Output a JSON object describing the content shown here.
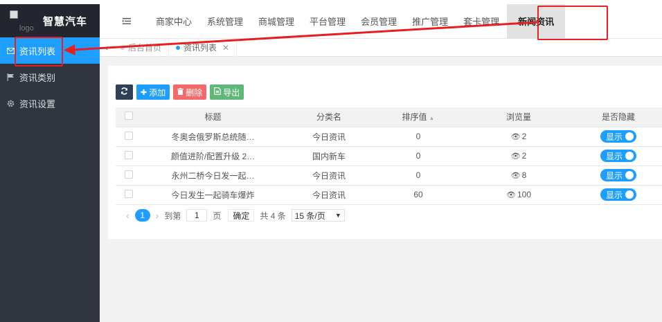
{
  "sidebar": {
    "logo_alt": "logo",
    "title": "智慧汽车",
    "items": [
      {
        "label": "资讯列表",
        "icon": "envelope-icon",
        "active": true
      },
      {
        "label": "资讯类别",
        "icon": "flag-icon",
        "active": false
      },
      {
        "label": "资讯设置",
        "icon": "gear-icon",
        "active": false
      }
    ]
  },
  "topnav": {
    "items": [
      "商家中心",
      "系统管理",
      "商城管理",
      "平台管理",
      "会员管理",
      "推广管理",
      "套卡管理",
      "新闻资讯"
    ],
    "active_index": 7
  },
  "tabs": {
    "items": [
      {
        "label": "后台首页",
        "active": false
      },
      {
        "label": "资讯列表",
        "active": true,
        "closable": true
      }
    ]
  },
  "toolbar": {
    "refresh_icon": "refresh-icon",
    "add_label": "添加",
    "delete_label": "删除",
    "export_label": "导出"
  },
  "table": {
    "headers": {
      "title": "标题",
      "category": "分类名",
      "sort": "排序值",
      "views": "浏览量",
      "hidden": "是否隐藏"
    },
    "rows": [
      {
        "title": "冬奥会俄罗斯总统随…",
        "category": "今日资讯",
        "sort": "0",
        "views": "2",
        "switch": "显示"
      },
      {
        "title": "颜值进阶/配置升级 2…",
        "category": "国内新车",
        "sort": "0",
        "views": "2",
        "switch": "显示"
      },
      {
        "title": "永州二桥今日发一起…",
        "category": "今日资讯",
        "sort": "0",
        "views": "8",
        "switch": "显示"
      },
      {
        "title": "今日发生一起骑车爆炸",
        "category": "今日资讯",
        "sort": "60",
        "views": "100",
        "switch": "显示"
      }
    ]
  },
  "pager": {
    "current": "1",
    "goto_label": "到第",
    "goto_value": "1",
    "page_unit": "页",
    "confirm": "确定",
    "total": "共 4 条",
    "page_size": "15 条/页"
  },
  "colors": {
    "accent": "#1e9fff",
    "sidebar_bg": "#2f3640",
    "annotation": "#e62020",
    "delete": "#f36a6a",
    "export": "#5fb878"
  }
}
